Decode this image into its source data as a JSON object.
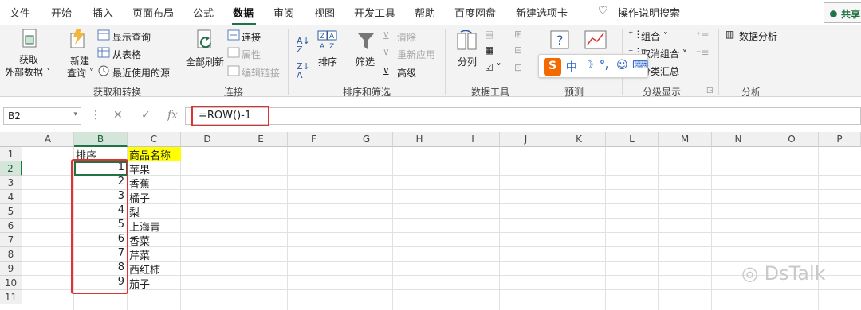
{
  "menubar": {
    "tabs": [
      "文件",
      "开始",
      "插入",
      "页面布局",
      "公式",
      "数据",
      "审阅",
      "视图",
      "开发工具",
      "帮助",
      "百度网盘",
      "新建选项卡"
    ],
    "active_tab": "数据",
    "tell_me": "操作说明搜索",
    "share": "共享"
  },
  "ribbon": {
    "get_transform": {
      "get_data_l1": "获取",
      "get_data_l2": "外部数据",
      "new_query_l1": "新建",
      "new_query_l2": "查询",
      "show_queries": "显示查询",
      "from_table": "从表格",
      "recent_sources": "最近使用的源",
      "group_label": "获取和转换"
    },
    "connections": {
      "refresh_all": "全部刷新",
      "connections": "连接",
      "properties": "属性",
      "edit_links": "编辑链接",
      "group_label": "连接"
    },
    "sort_filter": {
      "sort": "排序",
      "filter": "筛选",
      "clear": "清除",
      "reapply": "重新应用",
      "advanced": "高级",
      "group_label": "排序和筛选"
    },
    "data_tools": {
      "split": "分列",
      "group_label": "数据工具"
    },
    "forecast": {
      "group_label": "预测"
    },
    "outline": {
      "group": "组合",
      "ungroup": "取消组合",
      "subtotal": "分类汇总",
      "group_label": "分级显示"
    },
    "analysis": {
      "data_analysis": "数据分析",
      "group_label": "分析"
    }
  },
  "ime_toolbar": {
    "logo": "S",
    "lang": "中",
    "moon": "☽",
    "punct": "°,",
    "emoji": "☺",
    "keyboard": "⌨"
  },
  "formula_bar": {
    "name_box": "B2",
    "formula": "=ROW()-1"
  },
  "sheet": {
    "columns": [
      "A",
      "B",
      "C",
      "D",
      "E",
      "F",
      "G",
      "H",
      "I",
      "J",
      "K",
      "L",
      "M",
      "N",
      "O",
      "P"
    ],
    "rows": [
      "1",
      "2",
      "3",
      "4",
      "5",
      "6",
      "7",
      "8",
      "9",
      "10",
      "11"
    ],
    "header_b1": "排序",
    "header_c1": "商品名称",
    "b_values": [
      "1",
      "2",
      "3",
      "4",
      "5",
      "6",
      "7",
      "8",
      "9"
    ],
    "c_values": [
      "苹果",
      "香蕉",
      "橘子",
      "梨",
      "上海青",
      "香菜",
      "芹菜",
      "西红柿",
      "茄子"
    ]
  },
  "watermark": "DsTalk",
  "colors": {
    "accent": "#217346",
    "highlight_red": "#e03030",
    "header_yellow": "#ffff00"
  }
}
